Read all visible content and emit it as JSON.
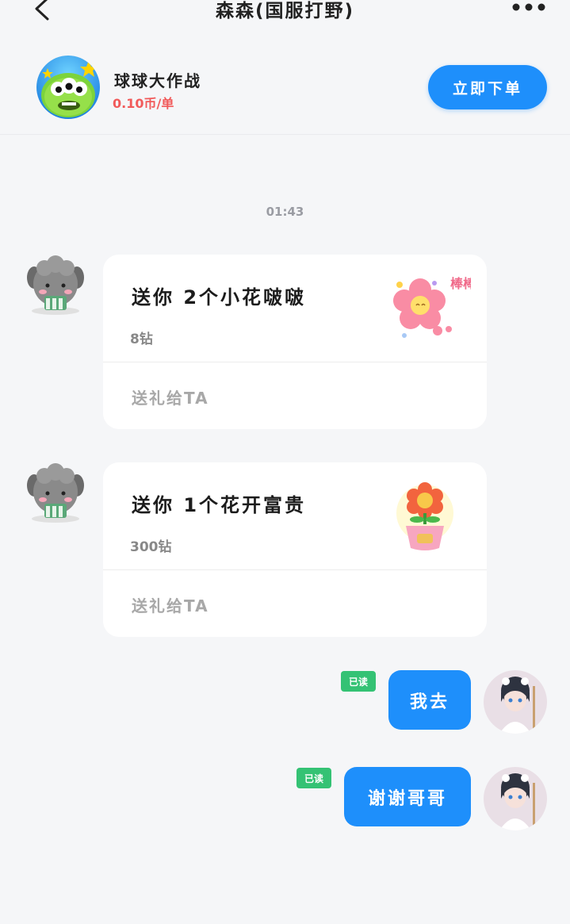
{
  "header": {
    "title": "森森(国服打野)"
  },
  "order": {
    "game_name": "球球大作战",
    "price": "0.10币/单",
    "order_button": "立即下单"
  },
  "chat": {
    "timestamp": "01:43",
    "gifts": [
      {
        "title": "送你 2个小花啵啵",
        "price": "8钻",
        "action": "送礼给TA",
        "image_text": "棒棒！"
      },
      {
        "title": "送你 1个花开富贵",
        "price": "300钻",
        "action": "送礼给TA",
        "image_text": ""
      }
    ],
    "messages": [
      {
        "text": "我去",
        "status": "已读"
      },
      {
        "text": "谢谢哥哥",
        "status": "已读"
      }
    ]
  },
  "colors": {
    "accent": "#1e8ffb",
    "price": "#f15a5a",
    "read": "#34c274",
    "background": "#f5f6f8"
  },
  "icons": {
    "back": "chevron-left-icon",
    "more": "more-dots-icon"
  }
}
